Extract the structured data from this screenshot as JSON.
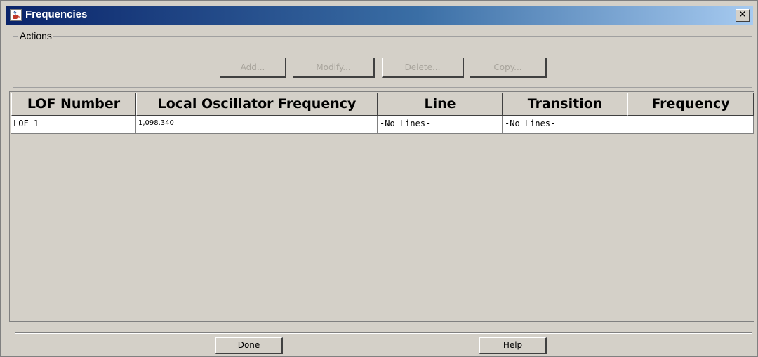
{
  "window": {
    "title": "Frequencies",
    "close_label": "✕"
  },
  "actions": {
    "group_label": "Actions",
    "buttons": [
      {
        "label": "Add...",
        "enabled": false
      },
      {
        "label": "Modify...",
        "enabled": false
      },
      {
        "label": "Delete...",
        "enabled": false
      },
      {
        "label": "Copy...",
        "enabled": false
      }
    ]
  },
  "table": {
    "columns": [
      "LOF Number",
      "Local Oscillator Frequency",
      "Line",
      "Transition",
      "Frequency"
    ],
    "rows": [
      [
        "LOF 1",
        "1,098.340",
        "-No Lines-",
        "-No Lines-",
        ""
      ]
    ]
  },
  "footer": {
    "done_label": "Done",
    "help_label": "Help"
  },
  "icons": {
    "title_icon": "java-cup-icon",
    "close_icon": "close-icon"
  }
}
